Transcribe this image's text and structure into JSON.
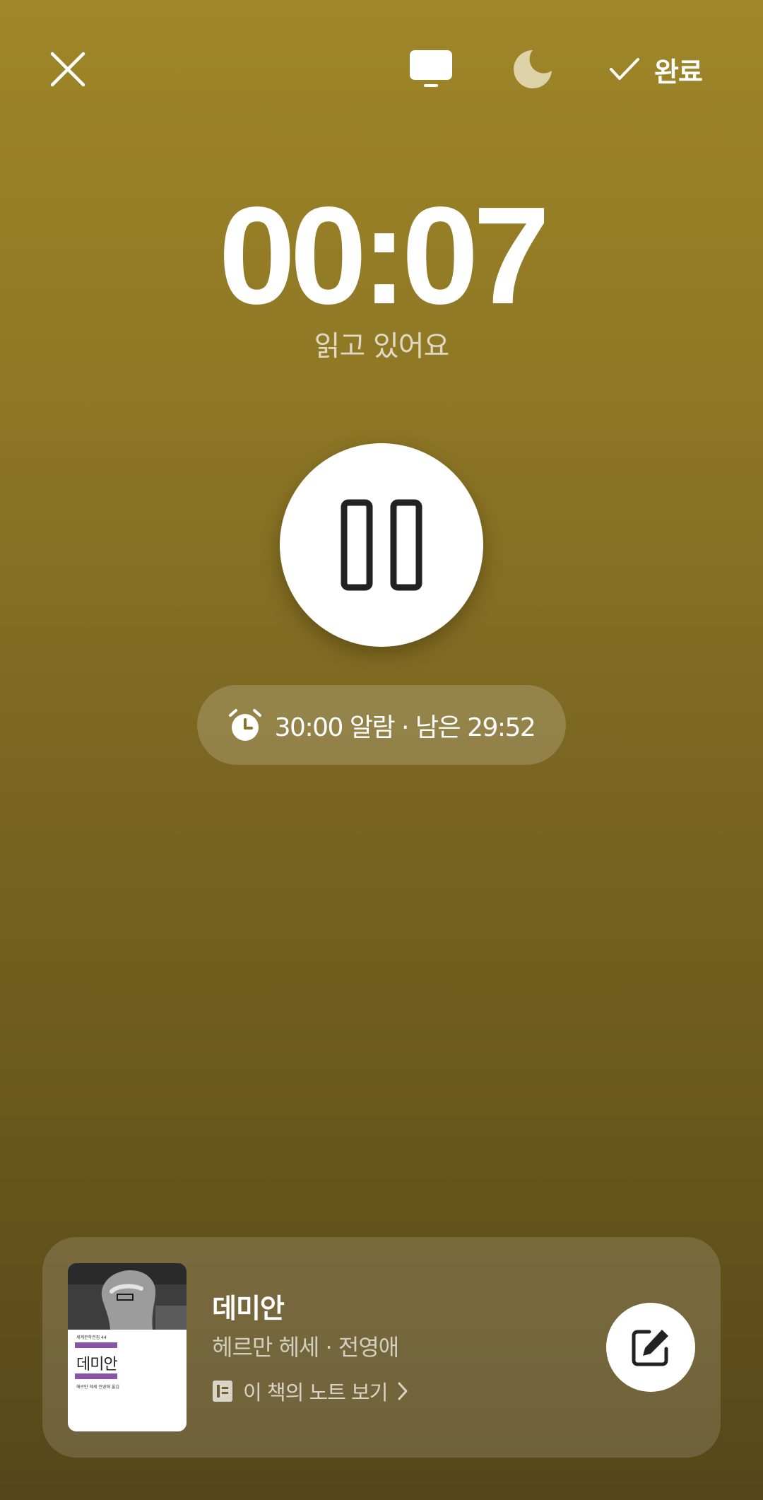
{
  "header": {
    "close_icon": "close-icon",
    "screen_icon": "monitor-icon",
    "night_icon": "moon-icon",
    "done_label": "완료",
    "done_icon": "check-icon"
  },
  "timer": {
    "elapsed": "00:07",
    "status": "읽고 있어요"
  },
  "controls": {
    "pause_icon": "pause-icon"
  },
  "alarm": {
    "icon": "alarm-clock-icon",
    "text": "30:00 알람 · 남은 29:52"
  },
  "book": {
    "title": "데미안",
    "author_translator": "헤르만 헤세 · 전영애",
    "note_link_label": "이 책의 노트 보기",
    "note_icon": "note-icon",
    "note_chevron": "chevron-right-icon",
    "edit_icon": "edit-note-icon",
    "cover": {
      "series": "세계문학전집 44",
      "title": "데미안",
      "author": "헤르만 헤세 전영애 옮김",
      "accent_color": "#8a53a8"
    }
  },
  "colors": {
    "background_top": "#9f8629",
    "background_bottom": "#56461a",
    "foreground": "#ffffff",
    "icon_dark": "#222222"
  }
}
